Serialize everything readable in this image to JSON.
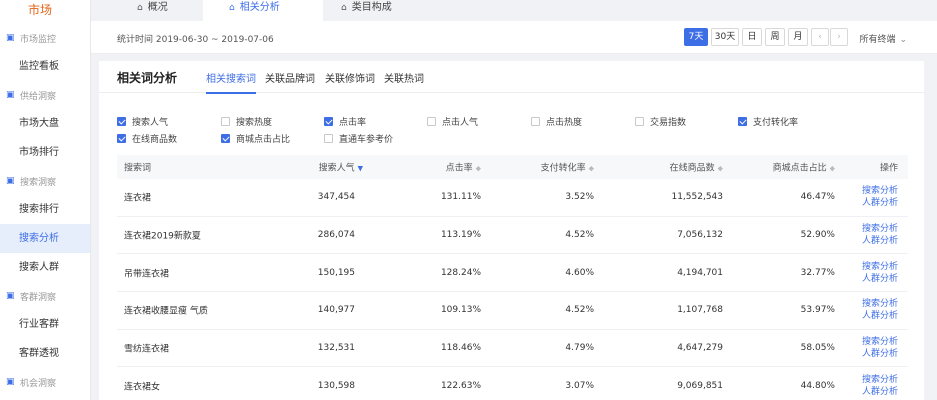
{
  "sidebar": {
    "brand": "市场",
    "sections": [
      {
        "group": "市场监控",
        "icon": "monitor-icon",
        "items": [
          {
            "label": "监控看板",
            "active": false
          }
        ]
      },
      {
        "group": "供给洞察",
        "icon": "insight-icon",
        "items": [
          {
            "label": "市场大盘",
            "active": false
          },
          {
            "label": "市场排行",
            "active": false
          }
        ]
      },
      {
        "group": "搜索洞察",
        "icon": "search-insight-icon",
        "items": [
          {
            "label": "搜索排行",
            "active": false
          },
          {
            "label": "搜索分析",
            "active": true
          },
          {
            "label": "搜索人群",
            "active": false
          }
        ]
      },
      {
        "group": "客群洞察",
        "icon": "crowd-icon",
        "items": [
          {
            "label": "行业客群",
            "active": false
          },
          {
            "label": "客群透视",
            "active": false
          }
        ]
      },
      {
        "group": "机会洞察",
        "icon": "opportunity-icon",
        "items": []
      }
    ]
  },
  "top_tabs": [
    {
      "label": "概况",
      "active": false
    },
    {
      "label": "相关分析",
      "active": true
    },
    {
      "label": "类目构成",
      "active": false
    }
  ],
  "datebar": {
    "range": "统计时间 2019-06-30 ~ 2019-07-06",
    "buttons": [
      "7天",
      "30天",
      "日",
      "周",
      "月"
    ],
    "active_button": "7天",
    "prev": "‹",
    "next": "›",
    "terminal": "所有终端"
  },
  "panel": {
    "title": "相关词分析",
    "tabs": [
      {
        "label": "相关搜索词",
        "active": true
      },
      {
        "label": "关联品牌词",
        "active": false
      },
      {
        "label": "关联修饰词",
        "active": false
      },
      {
        "label": "关联热词",
        "active": false
      }
    ]
  },
  "metrics": [
    {
      "label": "搜索人气",
      "checked": true
    },
    {
      "label": "搜索热度",
      "checked": false
    },
    {
      "label": "点击率",
      "checked": true
    },
    {
      "label": "点击人气",
      "checked": false
    },
    {
      "label": "点击热度",
      "checked": false
    },
    {
      "label": "交易指数",
      "checked": false
    },
    {
      "label": "支付转化率",
      "checked": true
    },
    {
      "label": "在线商品数",
      "checked": true
    },
    {
      "label": "商城点击占比",
      "checked": true
    },
    {
      "label": "直通车参考价",
      "checked": false
    }
  ],
  "table": {
    "headers": [
      "搜索词",
      "搜索人气",
      "点击率",
      "支付转化率",
      "在线商品数",
      "商城点击占比",
      "操作"
    ],
    "sort_marks": [
      "",
      "▼",
      "◆",
      "◆",
      "◆",
      "◆",
      ""
    ],
    "rows": [
      [
        "连衣裙",
        "347,454",
        "131.11%",
        "3.52%",
        "11,552,543",
        "46.47%"
      ],
      [
        "连衣裙2019新款夏",
        "286,074",
        "113.19%",
        "4.52%",
        "7,056,132",
        "52.90%"
      ],
      [
        "吊带连衣裙",
        "150,195",
        "128.24%",
        "4.60%",
        "4,194,701",
        "32.77%"
      ],
      [
        "连衣裙收腰显瘦 气质",
        "140,977",
        "109.13%",
        "4.52%",
        "1,107,768",
        "53.97%"
      ],
      [
        "雪纺连衣裙",
        "132,531",
        "118.46%",
        "4.79%",
        "4,647,279",
        "58.05%"
      ],
      [
        "连衣裙女",
        "130,598",
        "122.63%",
        "3.07%",
        "9,069,851",
        "44.80%"
      ]
    ],
    "op_links": [
      "搜索分析",
      "人群分析"
    ]
  },
  "colors": {
    "accent": "#3e6ee6",
    "brand": "#e5651b"
  }
}
